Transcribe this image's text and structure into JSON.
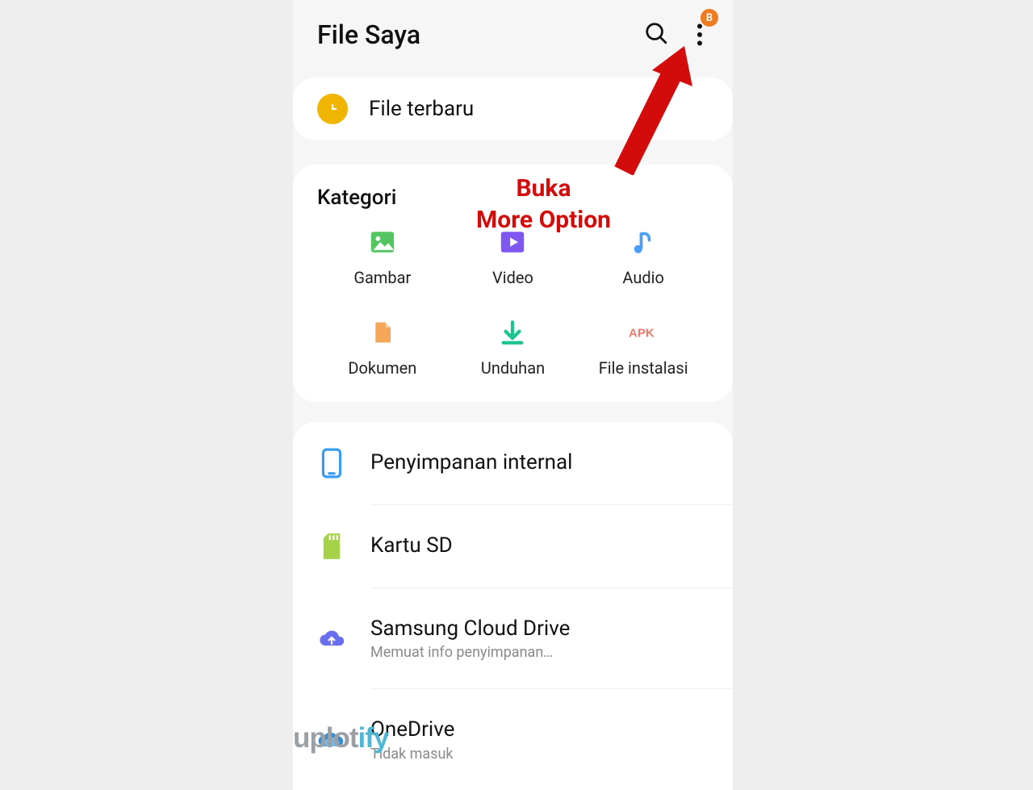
{
  "header": {
    "title": "File Saya",
    "badge": "B"
  },
  "recent": {
    "label": "File terbaru"
  },
  "categories": {
    "title": "Kategori",
    "items": [
      {
        "label": "Gambar"
      },
      {
        "label": "Video"
      },
      {
        "label": "Audio"
      },
      {
        "label": "Dokumen"
      },
      {
        "label": "Unduhan"
      },
      {
        "label": "File instalasi"
      }
    ]
  },
  "storage": {
    "items": [
      {
        "title": "Penyimpanan internal",
        "sub": ""
      },
      {
        "title": "Kartu SD",
        "sub": ""
      },
      {
        "title": "Samsung Cloud Drive",
        "sub": "Memuat info penyimpanan…"
      },
      {
        "title": "OneDrive",
        "sub": "Tidak masuk"
      }
    ]
  },
  "annotation": {
    "line1": "Buka",
    "line2": "More Option"
  },
  "watermark": {
    "part1": "uplot",
    "part2": "ify"
  },
  "colors": {
    "accent_clock": "#f0b500",
    "badge": "#ee7b22",
    "annotation": "#d40b0b",
    "image_green": "#54c561",
    "video_purple": "#7e57f0",
    "audio_blue": "#4a9ef5",
    "doc_orange": "#f5a757",
    "download_teal": "#1cc48f",
    "apk_coral": "#f07a6c",
    "internal_blue": "#3a9cf0",
    "sd_green": "#a6d24a",
    "cloud_indigo": "#6a6ff0",
    "onedrive_blue": "#2f8fd8"
  }
}
